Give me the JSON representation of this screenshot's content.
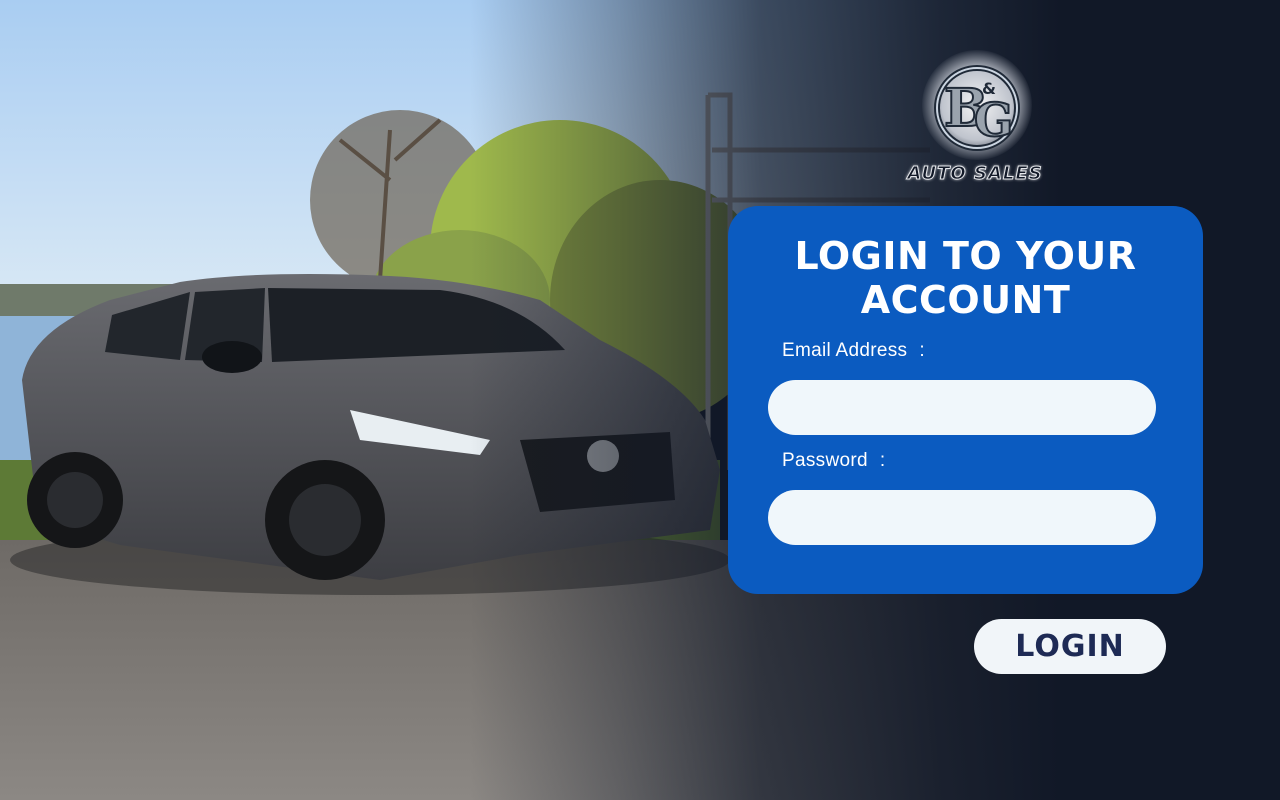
{
  "brand": {
    "logo_monogram": "B&G",
    "logo_text": "AUTO SALES"
  },
  "login_card": {
    "title": "LOGIN TO YOUR ACCOUNT",
    "email_label": "Email Address",
    "password_label": "Password",
    "label_separator": ":",
    "email_value": "",
    "password_value": ""
  },
  "actions": {
    "login_label": "LOGIN"
  },
  "colors": {
    "card": "#0b5bc0",
    "input_bg": "#f0f7fb",
    "button_bg": "#f1f5f9",
    "button_text": "#1e2a55",
    "page_dark": "#111827"
  },
  "icons": {
    "logo": "bg-auto-sales-logo"
  }
}
